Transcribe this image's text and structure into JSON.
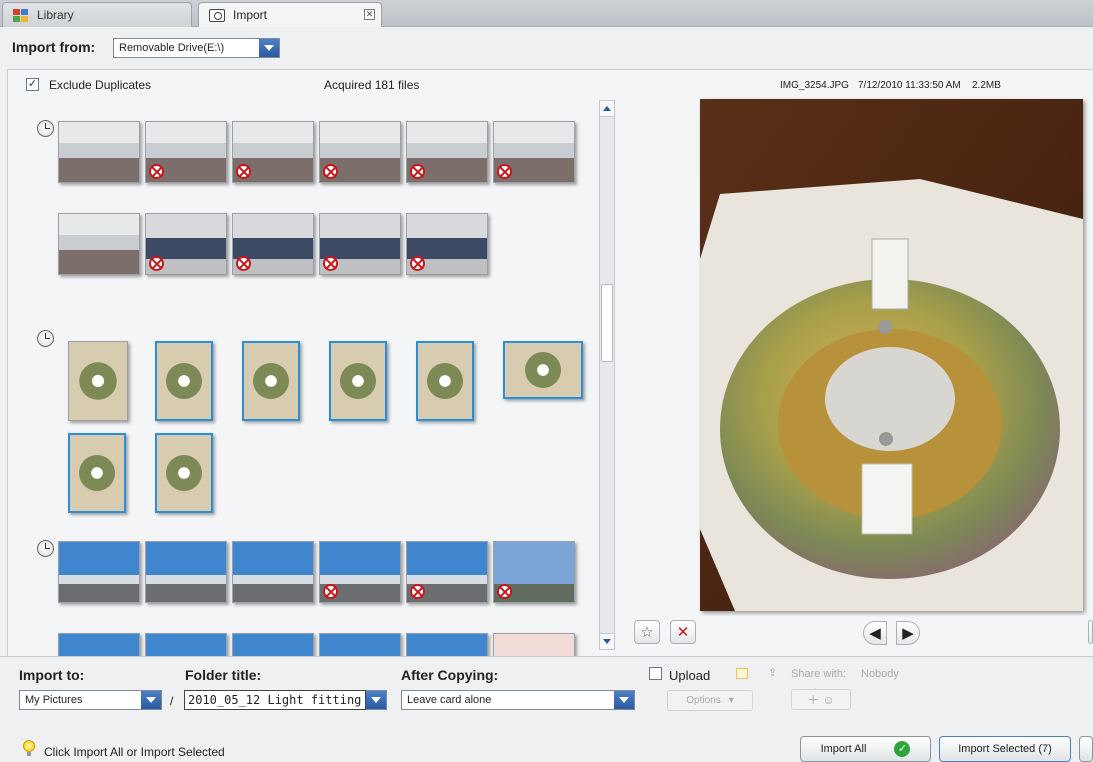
{
  "tabs": [
    {
      "label": "Library",
      "icon": "library-icon"
    },
    {
      "label": "Import",
      "icon": "import-camera-icon"
    }
  ],
  "import_from": {
    "label": "Import from:",
    "selected": "Removable Drive(E:\\)"
  },
  "toolbar": {
    "exclude_duplicates_label": "Exclude Duplicates",
    "exclude_duplicates_checked": true,
    "acquired_text": "Acquired 181 files"
  },
  "file_info": {
    "name": "IMG_3254.JPG",
    "datetime": "7/12/2010 11:33:50 AM",
    "size": "2.2MB"
  },
  "groups": [
    {
      "thumbs": [
        {
          "duplicate": false,
          "selected": false,
          "scene": "room"
        },
        {
          "duplicate": true,
          "selected": false,
          "scene": "room"
        },
        {
          "duplicate": true,
          "selected": false,
          "scene": "room"
        },
        {
          "duplicate": true,
          "selected": false,
          "scene": "room"
        },
        {
          "duplicate": true,
          "selected": false,
          "scene": "room"
        },
        {
          "duplicate": true,
          "selected": false,
          "scene": "room"
        },
        {
          "duplicate": false,
          "selected": false,
          "scene": "room"
        },
        {
          "duplicate": true,
          "selected": false,
          "scene": "desks"
        },
        {
          "duplicate": true,
          "selected": false,
          "scene": "desks"
        },
        {
          "duplicate": true,
          "selected": false,
          "scene": "desks"
        },
        {
          "duplicate": true,
          "selected": false,
          "scene": "desks"
        }
      ]
    },
    {
      "thumbs": [
        {
          "duplicate": false,
          "selected": false,
          "scene": "fitting"
        },
        {
          "duplicate": false,
          "selected": true,
          "scene": "fitting"
        },
        {
          "duplicate": false,
          "selected": true,
          "scene": "fitting"
        },
        {
          "duplicate": false,
          "selected": true,
          "scene": "fitting"
        },
        {
          "duplicate": false,
          "selected": true,
          "scene": "fitting"
        },
        {
          "duplicate": false,
          "selected": true,
          "scene": "fitting"
        },
        {
          "duplicate": false,
          "selected": true,
          "scene": "fitting"
        },
        {
          "duplicate": false,
          "selected": true,
          "scene": "fitting"
        }
      ]
    },
    {
      "thumbs": [
        {
          "duplicate": false,
          "selected": false,
          "scene": "outdoor"
        },
        {
          "duplicate": false,
          "selected": false,
          "scene": "outdoor"
        },
        {
          "duplicate": false,
          "selected": false,
          "scene": "outdoor"
        },
        {
          "duplicate": true,
          "selected": false,
          "scene": "outdoor"
        },
        {
          "duplicate": true,
          "selected": false,
          "scene": "outdoor"
        },
        {
          "duplicate": true,
          "selected": false,
          "scene": "sky"
        },
        {
          "duplicate": false,
          "selected": false,
          "scene": "outdoor"
        },
        {
          "duplicate": false,
          "selected": false,
          "scene": "outdoor"
        },
        {
          "duplicate": false,
          "selected": false,
          "scene": "outdoor"
        },
        {
          "duplicate": false,
          "selected": false,
          "scene": "outdoor"
        },
        {
          "duplicate": false,
          "selected": false,
          "scene": "outdoor"
        },
        {
          "duplicate": false,
          "selected": false,
          "scene": "face"
        }
      ]
    }
  ],
  "bottom": {
    "import_to_label": "Import to:",
    "import_to_value": "My Pictures",
    "separator": "/",
    "folder_title_label": "Folder title:",
    "folder_title_value": "2010_05_12 Light fitting",
    "after_copying_label": "After Copying:",
    "after_copying_value": "Leave card alone",
    "upload_label": "Upload",
    "upload_checked": false,
    "options_label": "Options",
    "share_with_label": "Share with:",
    "share_with_value": "Nobody",
    "tip_text": "Click Import All or Import Selected",
    "import_all_label": "Import All",
    "import_selected_label": "Import Selected (7)"
  },
  "colors": {
    "accent": "#2a5aa3",
    "selection": "#2a8fd6",
    "duplicate": "#c8161b",
    "ok_green": "#2fa43a"
  }
}
